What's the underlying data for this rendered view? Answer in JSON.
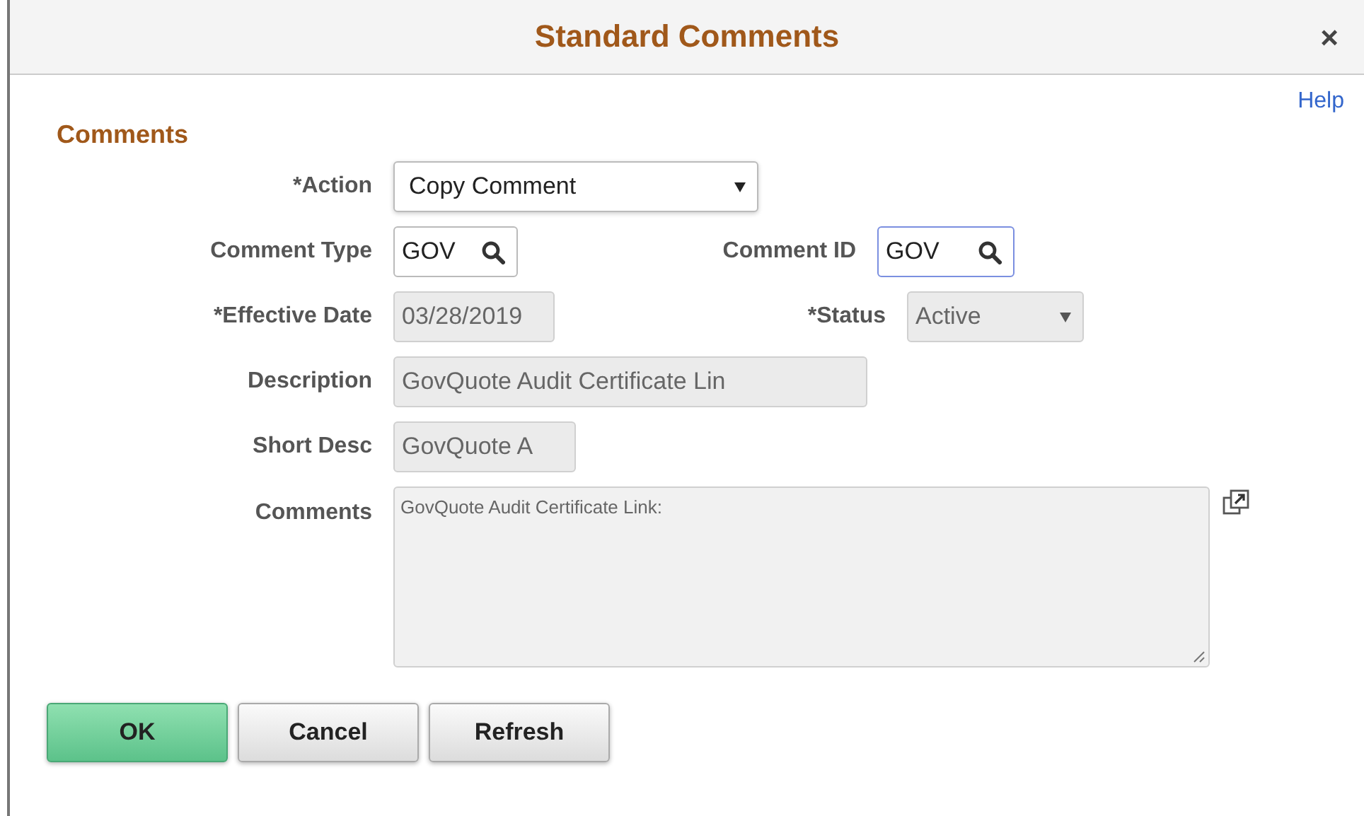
{
  "window": {
    "title": "Standard Comments",
    "close": "×"
  },
  "help_link": "Help",
  "section_title": "Comments",
  "rows": [
    {
      "fields": [
        {
          "label": "*Action",
          "kind": "select",
          "value": "Copy Comment",
          "disabled": false,
          "focused": false
        }
      ]
    },
    {
      "fields": [
        {
          "label": "Comment Type",
          "kind": "lookup",
          "value": "GOV",
          "disabled": false,
          "focused": false
        },
        {
          "label": "Comment ID",
          "kind": "lookup",
          "value": "GOV",
          "disabled": false,
          "focused": true
        }
      ]
    },
    {
      "fields": [
        {
          "label": "*Effective Date",
          "kind": "text",
          "value": "03/28/2019",
          "disabled": true,
          "focused": false
        },
        {
          "label": "*Status",
          "kind": "select",
          "value": "Active",
          "disabled": true,
          "focused": false
        }
      ]
    },
    {
      "fields": [
        {
          "label": "Description",
          "kind": "text",
          "value": "GovQuote Audit Certificate Lin",
          "disabled": true,
          "focused": false
        }
      ]
    },
    {
      "fields": [
        {
          "label": "Short Desc",
          "kind": "text",
          "value": "GovQuote A",
          "disabled": true,
          "focused": false
        }
      ]
    },
    {
      "fields": [
        {
          "label": "Comments",
          "kind": "textarea",
          "value": "GovQuote Audit Certificate Link:",
          "disabled": true,
          "focused": false
        }
      ]
    }
  ],
  "buttons": [
    {
      "label": "OK",
      "kind": "primary"
    },
    {
      "label": "Cancel",
      "kind": "default"
    },
    {
      "label": "Refresh",
      "kind": "default"
    }
  ]
}
